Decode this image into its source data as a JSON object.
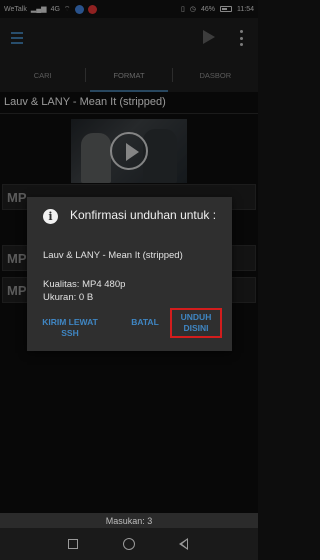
{
  "status_bar": {
    "left_labels": [
      "WeTalk",
      "4G"
    ],
    "battery": "46%",
    "time": "11:54"
  },
  "app_bar": {
    "menu_icon": "hamburger-menu-icon",
    "play_icon": "play-icon",
    "overflow_icon": "more-vert-icon",
    "accent_color": "#3e79a8"
  },
  "tabs": [
    {
      "label": "CARI"
    },
    {
      "label": "FORMAT"
    },
    {
      "label": "DASBOR"
    }
  ],
  "video": {
    "title": "Lauv & LANY - Mean It (stripped)"
  },
  "formats": [
    {
      "label": "MP"
    },
    {
      "label": "MP"
    },
    {
      "label": "MP"
    }
  ],
  "dialog": {
    "title": "Konfirmasi unduhan untuk :",
    "video_name": "Lauv & LANY - Mean It (stripped)",
    "quality": "Kualitas: MP4 480p",
    "size": "Ukuran: 0 B",
    "buttons": {
      "ssh": "KIRIM LEWAT SSH",
      "cancel": "BATAL",
      "download": "UNDUH DISINI"
    },
    "highlight_color": "#d31d1d"
  },
  "bottom_status": "Masukan: 3"
}
